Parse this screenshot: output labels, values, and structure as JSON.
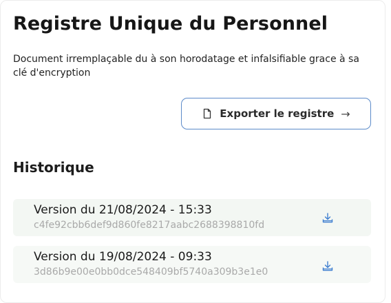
{
  "header": {
    "title": "Registre Unique du Personnel",
    "description": "Document irremplaçable du à son horodatage et infalsifiable grace à sa clé d'encryption"
  },
  "export_button": {
    "label": "Exporter le registre",
    "icon": "file-icon",
    "arrow": "→"
  },
  "history": {
    "title": "Historique",
    "versions": [
      {
        "title": "Version du 21/08/2024 - 15:33",
        "hash": "c4fe92cbb6def9d860fe8217aabc2688398810fd",
        "icon": "download-icon"
      },
      {
        "title": "Version du 19/08/2024 - 09:33",
        "hash": "3d86b9e00e0bb0dce548409bf5740a309b3e1e0",
        "icon": "download-icon"
      }
    ]
  },
  "colors": {
    "accent_border": "#5b8ac9",
    "download_icon": "#3f7fd0",
    "row_background": "#f3f7f3",
    "hash_text": "#a9a9a9"
  }
}
